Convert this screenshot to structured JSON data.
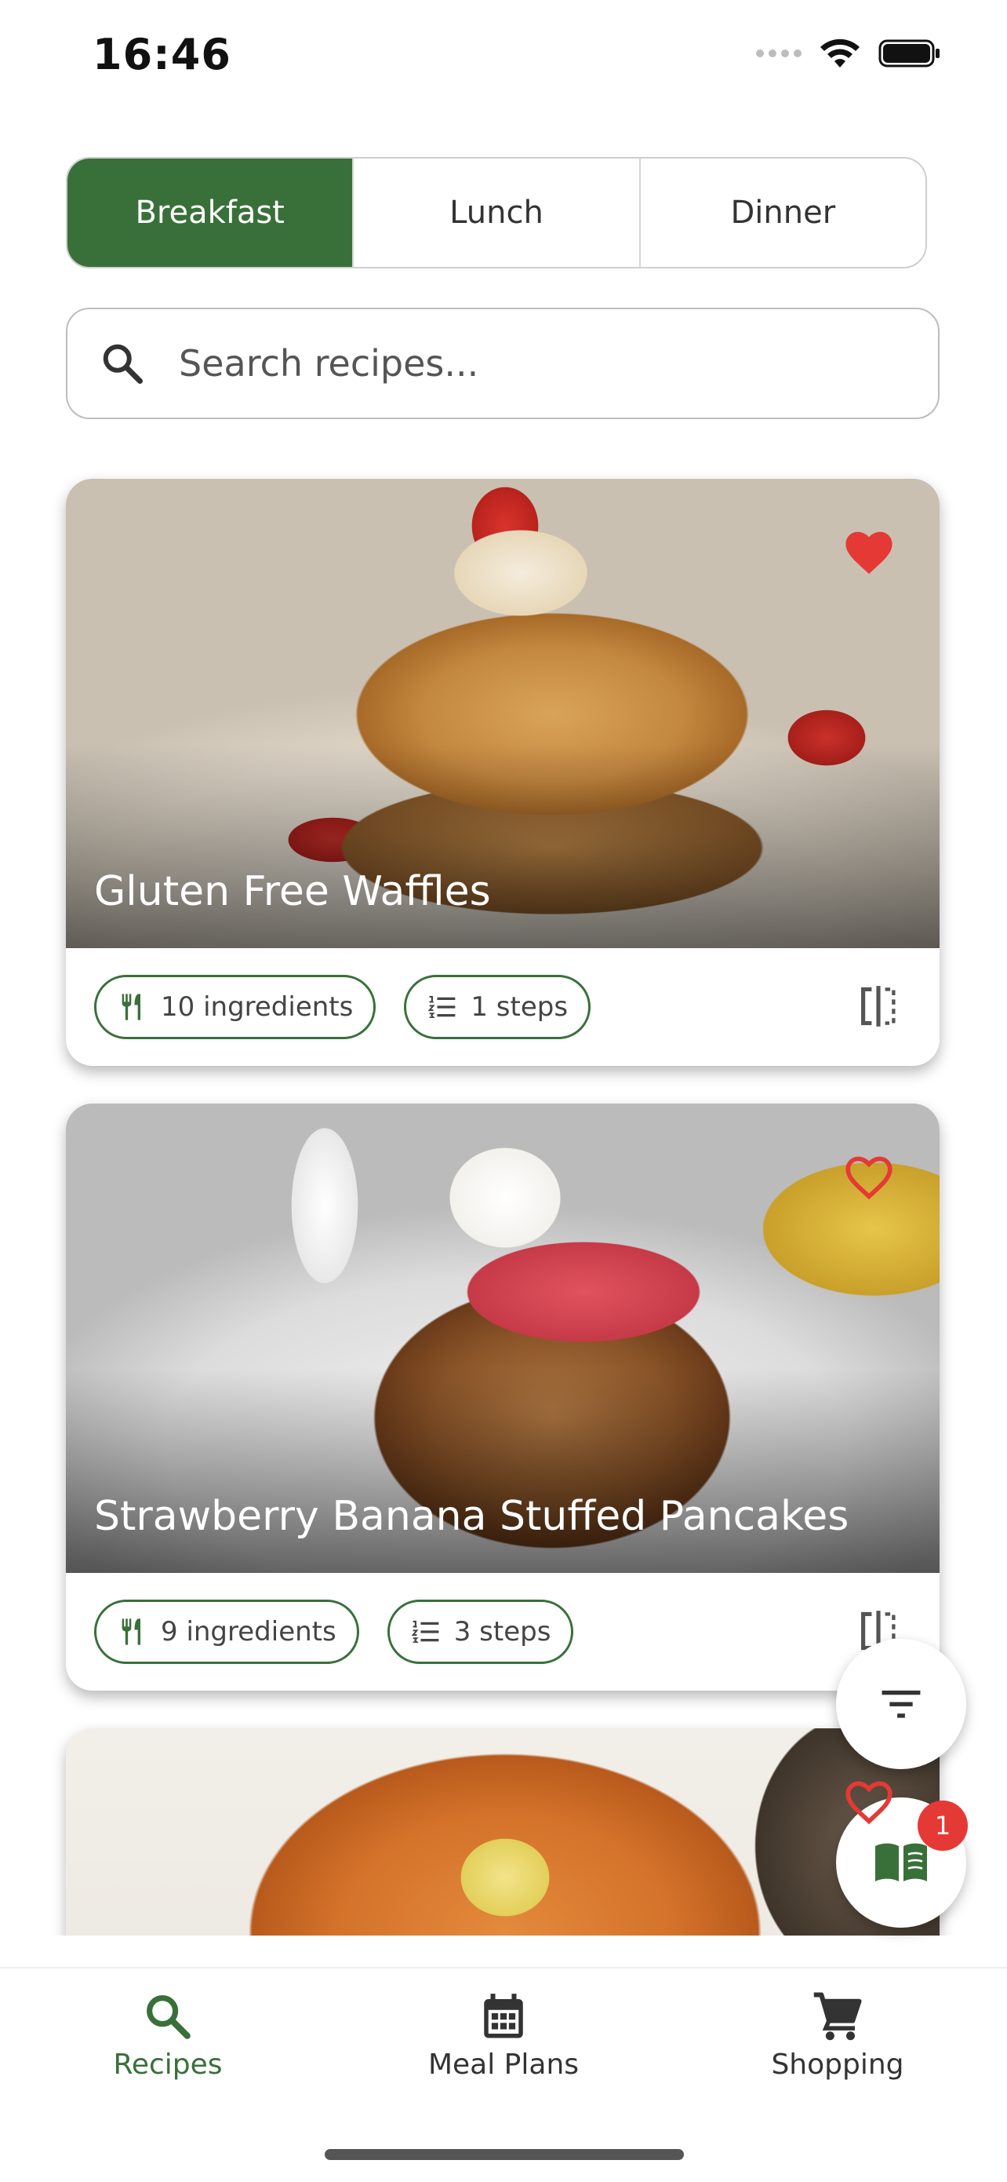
{
  "status_bar": {
    "time": "16:46"
  },
  "tabs": [
    {
      "label": "Breakfast",
      "active": true
    },
    {
      "label": "Lunch",
      "active": false
    },
    {
      "label": "Dinner",
      "active": false
    }
  ],
  "search": {
    "placeholder": "Search recipes..."
  },
  "recipes": [
    {
      "title": "Gluten Free Waffles",
      "favorite": true,
      "ingredients": "10 ingredients",
      "steps": "1 steps"
    },
    {
      "title": "Strawberry Banana Stuffed Pancakes",
      "favorite": false,
      "ingredients": "9 ingredients",
      "steps": "3 steps"
    },
    {
      "title": "",
      "favorite": false,
      "ingredients": "",
      "steps": ""
    }
  ],
  "fab": {
    "meal_plan_badge": "1"
  },
  "bottom_nav": [
    {
      "label": "Recipes",
      "icon": "search-icon",
      "active": true
    },
    {
      "label": "Meal Plans",
      "icon": "calendar-icon",
      "active": false
    },
    {
      "label": "Shopping",
      "icon": "cart-icon",
      "active": false
    }
  ],
  "colors": {
    "accent": "#39703a",
    "favorite": "#e53935",
    "badge": "#e53935"
  }
}
